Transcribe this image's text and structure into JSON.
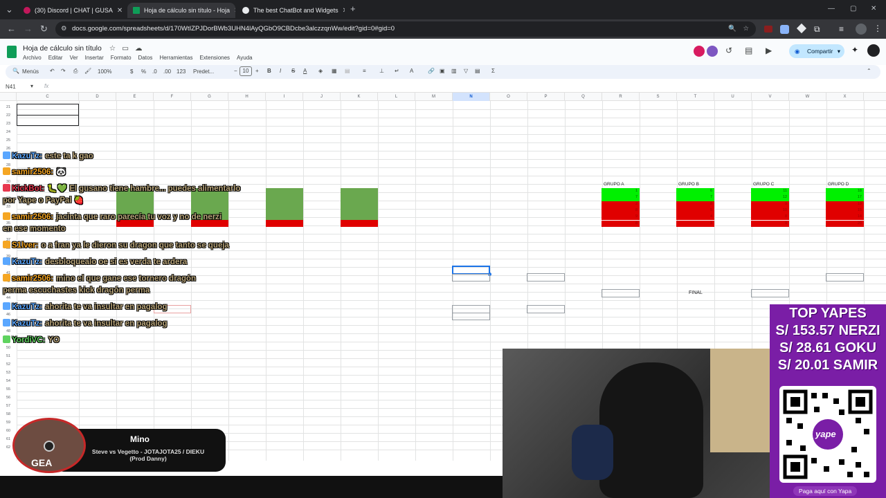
{
  "browser": {
    "tabs": [
      {
        "label": "(30) Discord | CHAT | GUSA",
        "active": false
      },
      {
        "label": "Hoja de cálculo sin título - Hoja",
        "active": true
      },
      {
        "label": "The best ChatBot and Widgets",
        "active": false
      }
    ],
    "url": "docs.google.com/spreadsheets/d/170WtIZPJDorBWb3UHN4lAyQGbO9CBDcbe3alczzqnWw/edit?gid=0#gid=0"
  },
  "sheets": {
    "title": "Hoja de cálculo sin título",
    "menu": [
      "Archivo",
      "Editar",
      "Ver",
      "Insertar",
      "Formato",
      "Datos",
      "Herramientas",
      "Extensiones",
      "Ayuda"
    ],
    "share_label": "Compartir",
    "toolbar": {
      "menus": "Menús",
      "zoom": "100%",
      "currency": "$",
      "percent": "%",
      "format123": "123",
      "font": "Predet...",
      "font_size": "10"
    },
    "name_box": "N41",
    "fx": "fx",
    "columns": [
      "C",
      "D",
      "E",
      "F",
      "G",
      "H",
      "I",
      "J",
      "K",
      "L",
      "M",
      "N",
      "O",
      "P",
      "Q",
      "R",
      "S",
      "T",
      "U",
      "V",
      "W",
      "X"
    ],
    "rows": [
      "21",
      "22",
      "23",
      "24",
      "25",
      "26",
      "27",
      "28",
      "29",
      "30",
      "31",
      "32",
      "33",
      "34",
      "35",
      "36",
      "37",
      "38",
      "39",
      "40",
      "41",
      "42",
      "43",
      "44",
      "45",
      "46",
      "47",
      "48",
      "49",
      "50",
      "51",
      "52",
      "53",
      "54",
      "55",
      "56",
      "57",
      "58",
      "59",
      "60",
      "61",
      "62"
    ],
    "groups": [
      {
        "label": "GRUPO A",
        "nums": [
          "1",
          "7",
          "2",
          "8",
          "9",
          "8"
        ]
      },
      {
        "label": "GRUPO B",
        "nums": [
          "6",
          "7",
          "8",
          "5",
          "4",
          "3"
        ]
      },
      {
        "label": "GRUPO C",
        "nums": [
          "11",
          "12",
          "9",
          "10",
          "8",
          "9"
        ]
      },
      {
        "label": "GRUPO D",
        "nums": [
          "18",
          "17",
          "19",
          "15",
          "14",
          "20"
        ]
      }
    ],
    "final_label": "FINAL"
  },
  "chat": [
    {
      "user": "KazuTz:",
      "msg": "este ta k gao",
      "color": "#5aa7ff"
    },
    {
      "user": "samir2506:",
      "msg": "🐼",
      "color": "#f5a623"
    },
    {
      "user": "KickBot:",
      "msg": "🐛💚 El gusano tiene hambre... puedes alimentarlo",
      "color": "#e8384f"
    },
    {
      "user": "",
      "msg": "por Yape o PayPal 🍓",
      "color": "#b9a57a"
    },
    {
      "user": "samir2506:",
      "msg": "jacinta que raro parecía tu voz y no de nerzi",
      "color": "#f5a623"
    },
    {
      "user": "",
      "msg": "en ese momento",
      "color": "#b9a57a"
    },
    {
      "user": "S1lver:",
      "msg": "o a fran ya le dieron su dragon que tanto se queja",
      "color": "#f5a623"
    },
    {
      "user": "KazuTz:",
      "msg": "desbloquealo oe si es verda te ardera",
      "color": "#5aa7ff"
    },
    {
      "user": "samir2506:",
      "msg": "mino el que gane ese tornero dragón",
      "color": "#f5a623"
    },
    {
      "user": "",
      "msg": "perma escuchastes kick dragón perma",
      "color": "#b9a57a"
    },
    {
      "user": "KazuTz:",
      "msg": "ahorita te va insultar en pagalog",
      "color": "#5aa7ff"
    },
    {
      "user": "KazuTz:",
      "msg": "ahorita te va insultar en pagalog",
      "color": "#5aa7ff"
    },
    {
      "user": "YordiVC:",
      "msg": "YO",
      "color": "#5fd35f"
    }
  ],
  "yape": {
    "heading": "TOP YAPES",
    "lines": [
      "S/ 153.57 NERZI",
      "S/ 28.61 GOKU",
      "S/ 20.01 SAMIR"
    ],
    "qr_label": "yape",
    "cta": "Paga aquí con Yapa"
  },
  "now_playing": {
    "title": "Mino",
    "artist": "Steve vs Vegetto - JOTAJOTA25 / DIEKU (Prod Danny)",
    "disc_text": "GEA"
  }
}
